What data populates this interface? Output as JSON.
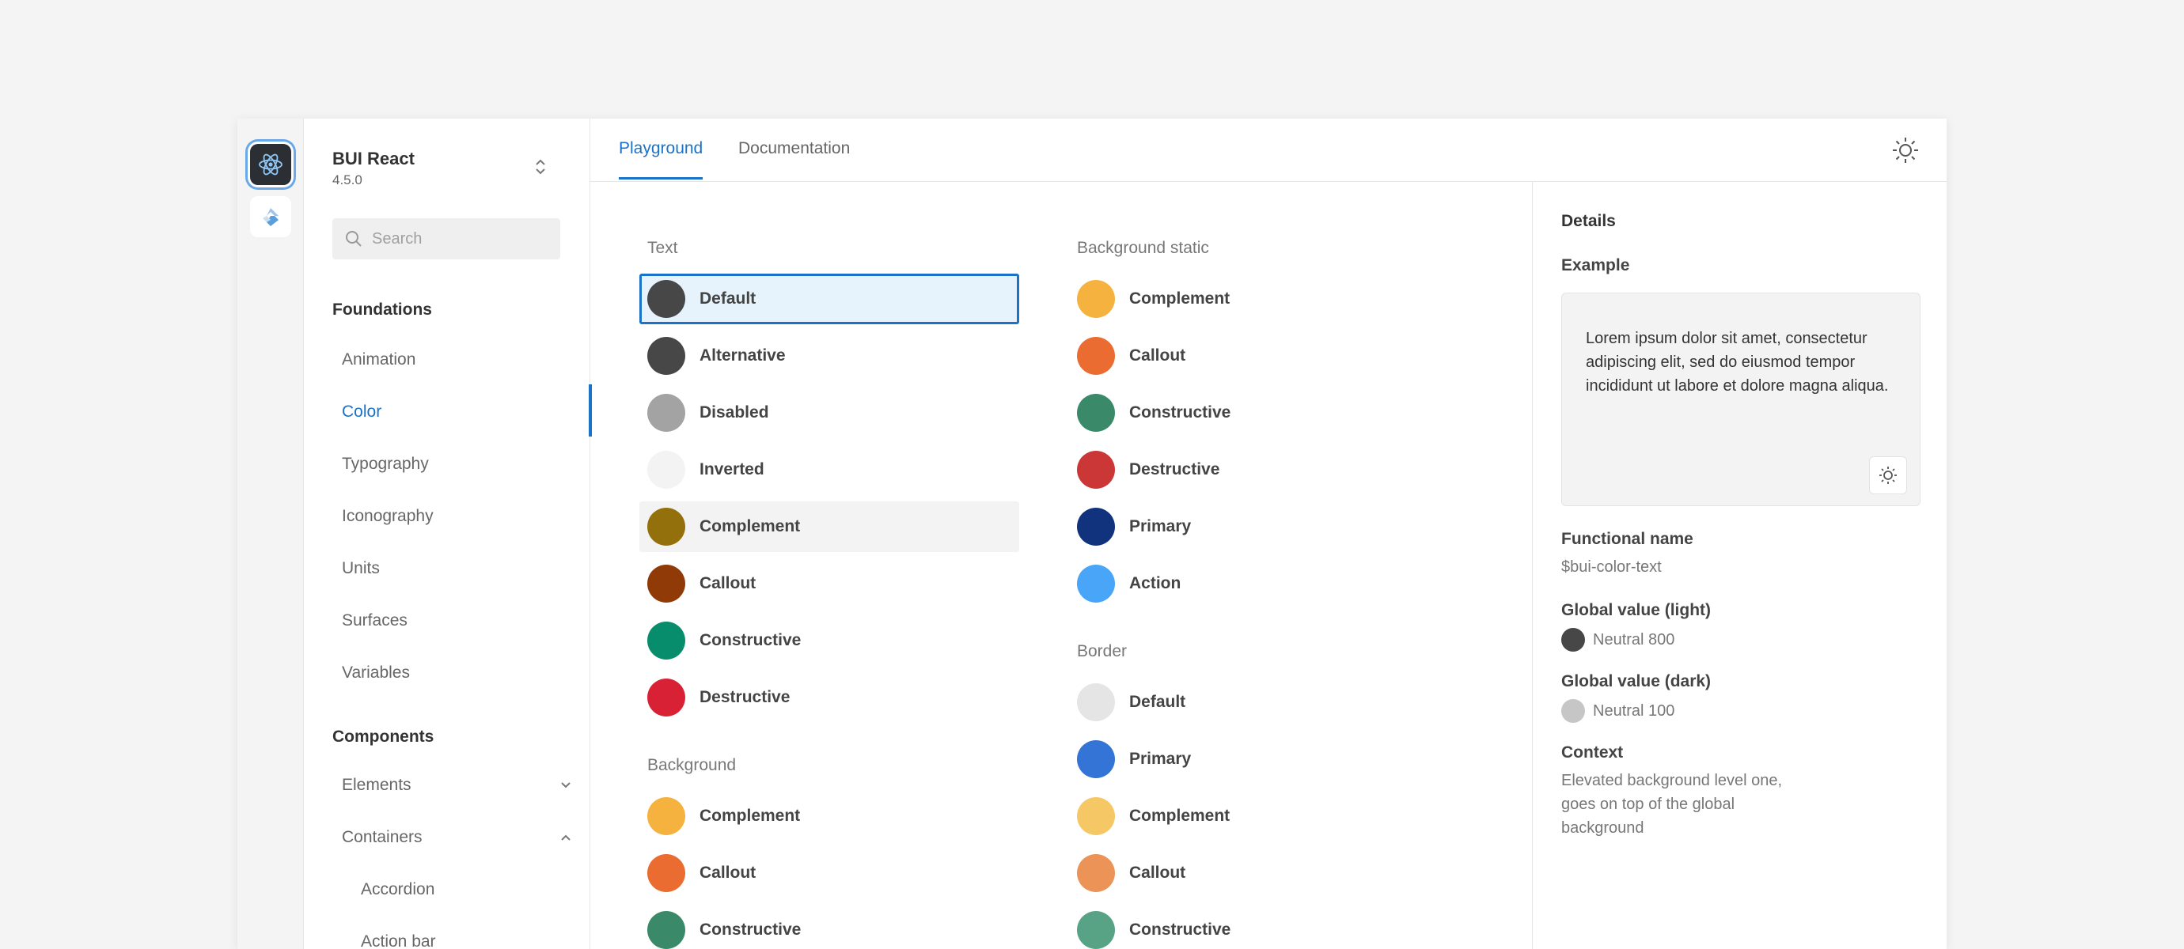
{
  "app": {
    "name": "BUI React",
    "version": "4.5.0"
  },
  "search": {
    "placeholder": "Search"
  },
  "nav": {
    "foundations_heading": "Foundations",
    "foundations": [
      "Animation",
      "Color",
      "Typography",
      "Iconography",
      "Units",
      "Surfaces",
      "Variables"
    ],
    "components_heading": "Components",
    "components": [
      "Elements",
      "Containers"
    ],
    "containers_sub": [
      "Accordion",
      "Action bar"
    ]
  },
  "tabs": [
    "Playground",
    "Documentation"
  ],
  "groups": {
    "text": {
      "title": "Text",
      "items": [
        {
          "label": "Default",
          "color": "#474747"
        },
        {
          "label": "Alternative",
          "color": "#474747"
        },
        {
          "label": "Disabled",
          "color": "#a3a3a3"
        },
        {
          "label": "Inverted",
          "color": "#f3f3f3"
        },
        {
          "label": "Complement",
          "color": "#94700c"
        },
        {
          "label": "Callout",
          "color": "#8f3a07"
        },
        {
          "label": "Constructive",
          "color": "#078c6c"
        },
        {
          "label": "Destructive",
          "color": "#d92136"
        }
      ]
    },
    "background": {
      "title": "Background",
      "items": [
        {
          "label": "Complement",
          "color": "#f6b23f"
        },
        {
          "label": "Callout",
          "color": "#ea6c30"
        },
        {
          "label": "Constructive",
          "color": "#3a8a6a"
        }
      ]
    },
    "background_static": {
      "title": "Background static",
      "items": [
        {
          "label": "Complement",
          "color": "#f6b23f"
        },
        {
          "label": "Callout",
          "color": "#ea6c30"
        },
        {
          "label": "Constructive",
          "color": "#3a8a6a"
        },
        {
          "label": "Destructive",
          "color": "#cb3737"
        },
        {
          "label": "Primary",
          "color": "#11337e"
        },
        {
          "label": "Action",
          "color": "#49a5f8"
        }
      ]
    },
    "border": {
      "title": "Border",
      "items": [
        {
          "label": "Default",
          "color": "#e5e5e5"
        },
        {
          "label": "Primary",
          "color": "#3374d6"
        },
        {
          "label": "Complement",
          "color": "#f6c865"
        },
        {
          "label": "Callout",
          "color": "#ec9358"
        },
        {
          "label": "Constructive",
          "color": "#58a386"
        }
      ]
    }
  },
  "details": {
    "title": "Details",
    "example_label": "Example",
    "example_text": "Lorem ipsum dolor sit amet, consectetur adipiscing elit, sed do eiusmod tempor incididunt ut labore et dolore magna aliqua.",
    "functional_name_label": "Functional name",
    "functional_name": "$bui-color-text",
    "global_light_label": "Global value (light)",
    "global_light": {
      "name": "Neutral 800",
      "color": "#474747"
    },
    "global_dark_label": "Global value (dark)",
    "global_dark": {
      "name": "Neutral 100",
      "color": "#c6c6c6"
    },
    "context_label": "Context",
    "context_text": "Elevated background level one, goes on top of the global background"
  },
  "colors": {
    "accent": "#1a73c8"
  }
}
